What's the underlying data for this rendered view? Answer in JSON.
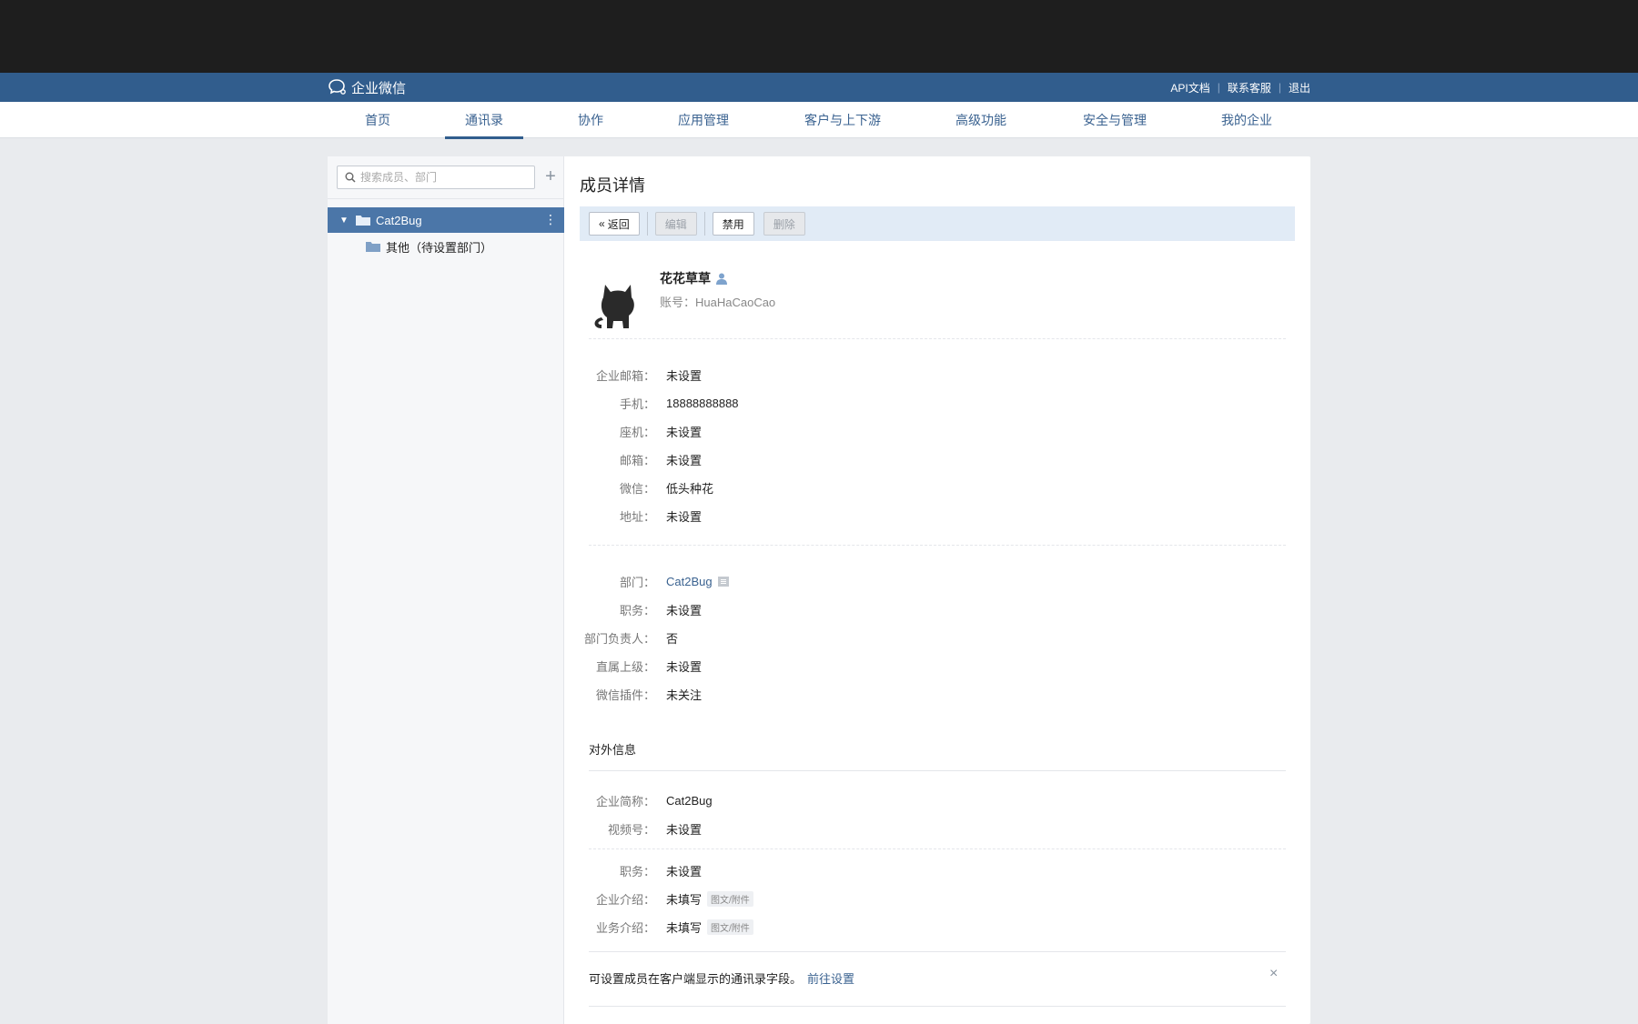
{
  "brand": {
    "name": "企业微信"
  },
  "toplinks": {
    "api": "API文档",
    "support": "联系客服",
    "logout": "退出"
  },
  "nav": [
    "首页",
    "通讯录",
    "协作",
    "应用管理",
    "客户与上下游",
    "高级功能",
    "安全与管理",
    "我的企业"
  ],
  "sidebar": {
    "search_placeholder": "搜索成员、部门",
    "add": "+",
    "root": "Cat2Bug",
    "child": "其他（待设置部门）"
  },
  "main": {
    "title": "成员详情",
    "buttons": {
      "back": "返回",
      "edit": "编辑",
      "disable": "禁用",
      "delete": "删除"
    },
    "user": {
      "name": "花花草草",
      "account": "账号：HuaHaCaoCao"
    },
    "contact": [
      {
        "k": "企业邮箱：",
        "v": "未设置"
      },
      {
        "k": "手机：",
        "v": "18888888888"
      },
      {
        "k": "座机：",
        "v": "未设置"
      },
      {
        "k": "邮箱：",
        "v": "未设置"
      },
      {
        "k": "微信：",
        "v": "低头种花"
      },
      {
        "k": "地址：",
        "v": "未设置"
      }
    ],
    "org": [
      {
        "k": "部门：",
        "v": "Cat2Bug"
      },
      {
        "k": "职务：",
        "v": "未设置"
      },
      {
        "k": "部门负责人：",
        "v": "否"
      },
      {
        "k": "直属上级：",
        "v": "未设置"
      },
      {
        "k": "微信插件：",
        "v": "未关注"
      }
    ],
    "external_title": "对外信息",
    "external": [
      {
        "k": "企业简称：",
        "v": "Cat2Bug"
      },
      {
        "k": "视频号：",
        "v": "未设置"
      }
    ],
    "external2": [
      {
        "k": "职务：",
        "v": "未设置",
        "tag": ""
      },
      {
        "k": "企业介绍：",
        "v": "未填写",
        "tag": "图文/附件"
      },
      {
        "k": "业务介绍：",
        "v": "未填写",
        "tag": "图文/附件"
      }
    ],
    "notice": "可设置成员在客户端显示的通讯录字段。",
    "notice_link": "前往设置",
    "close": "×"
  }
}
